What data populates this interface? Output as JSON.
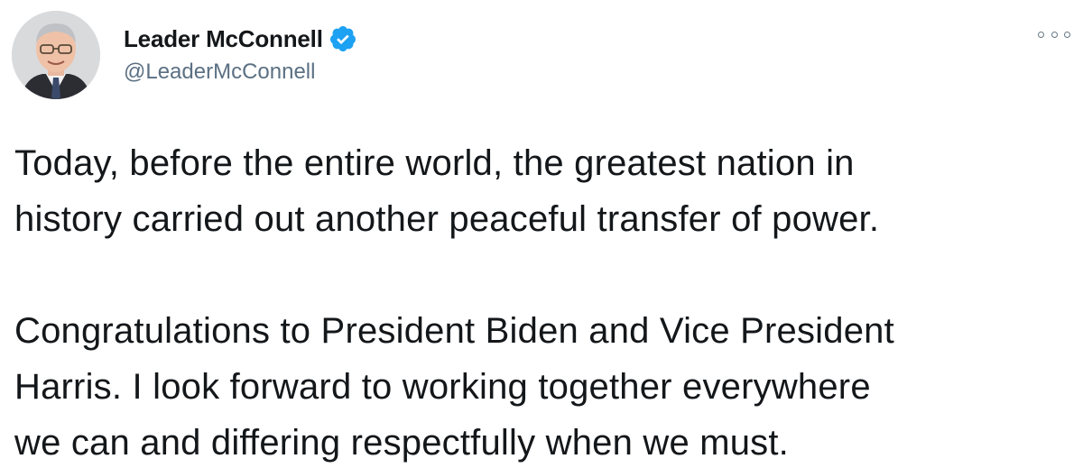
{
  "author": {
    "display_name": "Leader McConnell",
    "handle": "@LeaderMcConnell",
    "verified": true
  },
  "tweet": {
    "paragraphs": [
      "Today, before the entire world, the greatest nation in\nhistory carried out another peaceful transfer of power.",
      "Congratulations to President Biden and Vice President\nHarris. I look forward to working together everywhere\nwe can and differing respectfully when we must."
    ]
  },
  "icons": {
    "verified": "verified-badge-icon",
    "more": "more-options-icon"
  },
  "colors": {
    "verified_blue": "#1da1f2",
    "text": "#14171a",
    "secondary_text": "#5b7083"
  }
}
